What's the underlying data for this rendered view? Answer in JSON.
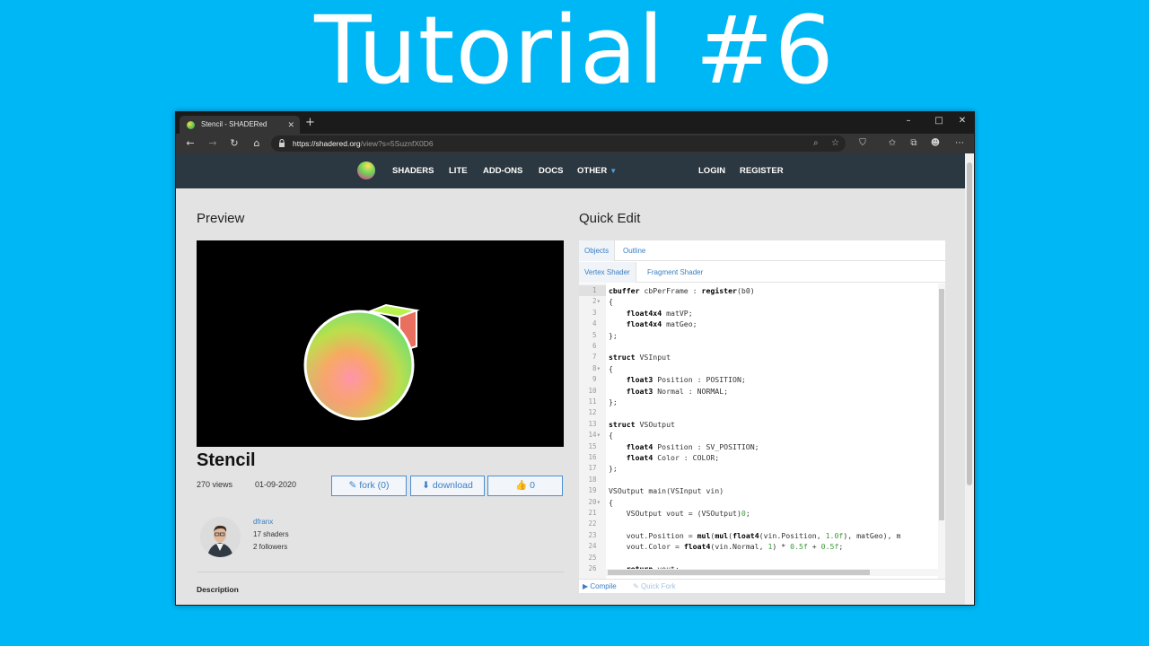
{
  "banner": {
    "title": "Tutorial #6"
  },
  "browser": {
    "tab_title": "Stencil - SHADERed",
    "url_host": "https://shadered.org",
    "url_path": "/view?s=5SuznfX0D6",
    "new_tab": "+",
    "controls": {
      "minimize": "–",
      "maximize": "□",
      "close": "✕"
    }
  },
  "site_nav": {
    "links": [
      "SHADERS",
      "LITE",
      "ADD-ONS",
      "DOCS",
      "OTHER"
    ],
    "login": "LOGIN",
    "register": "REGISTER"
  },
  "preview": {
    "heading": "Preview",
    "shader_name": "Stencil",
    "views": "270 views",
    "date": "01-09-2020",
    "fork_label": "fork (0)",
    "download_label": "download",
    "likes": "0"
  },
  "author": {
    "name": "dfranx",
    "shaders": "17 shaders",
    "followers": "2 followers"
  },
  "description_heading": "Description",
  "quick_edit": {
    "heading": "Quick Edit",
    "tabs": [
      "Objects",
      "Outline"
    ],
    "shader_tabs": [
      "Vertex Shader",
      "Fragment Shader"
    ],
    "compile_label": "Compile",
    "quick_fork_label": "Quick Fork",
    "code_lines": [
      "cbuffer cbPerFrame : register(b0)",
      "{",
      "    float4x4 matVP;",
      "    float4x4 matGeo;",
      "};",
      "",
      "struct VSInput",
      "{",
      "    float3 Position : POSITION;",
      "    float3 Normal : NORMAL;",
      "};",
      "",
      "struct VSOutput",
      "{",
      "    float4 Position : SV_POSITION;",
      "    float4 Color : COLOR;",
      "};",
      "",
      "VSOutput main(VSInput vin)",
      "{",
      "    VSOutput vout = (VSOutput)0;",
      "",
      "    vout.Position = mul(mul(float4(vin.Position, 1.0f), matGeo), m",
      "    vout.Color = float4(vin.Normal, 1) * 0.5f + 0.5f;",
      "",
      "    return vout;"
    ]
  }
}
